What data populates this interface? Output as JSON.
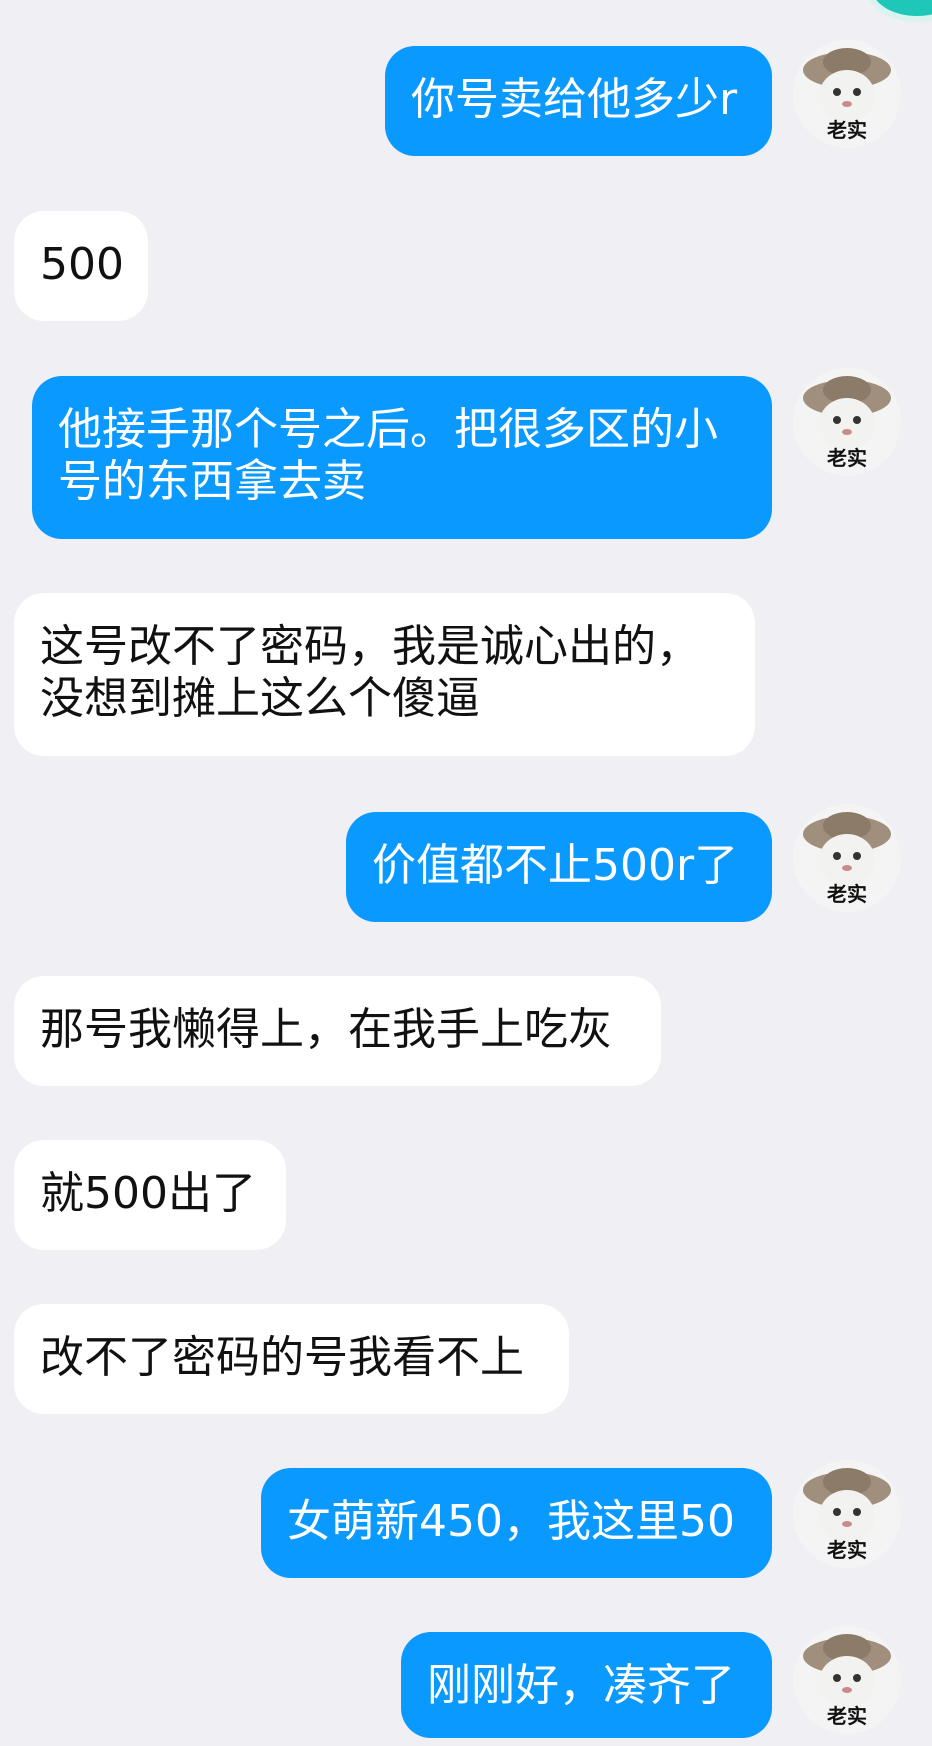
{
  "colors": {
    "background": "#efeff4",
    "outgoing_bubble": "#0a99ff",
    "incoming_bubble": "#ffffff"
  },
  "avatar": {
    "icon": "cat-with-hat-avatar-icon",
    "label": "老实"
  },
  "messages": [
    {
      "side": "right",
      "text": "你号卖给他多少r"
    },
    {
      "side": "left",
      "text": "500"
    },
    {
      "side": "right",
      "lines": [
        "他接手那个号之后。把很多区的小",
        "号的东西拿去卖"
      ]
    },
    {
      "side": "left",
      "lines": [
        "这号改不了密码，我是诚心出的，",
        "没想到摊上这么个傻逼"
      ]
    },
    {
      "side": "right",
      "text": "价值都不止500r了"
    },
    {
      "side": "left",
      "text": "那号我懒得上，在我手上吃灰"
    },
    {
      "side": "left",
      "text": "就500出了"
    },
    {
      "side": "left",
      "text": "改不了密码的号我看不上"
    },
    {
      "side": "right",
      "text": "女萌新450，我这里50"
    },
    {
      "side": "right",
      "text": "刚刚好，凑齐了"
    }
  ]
}
